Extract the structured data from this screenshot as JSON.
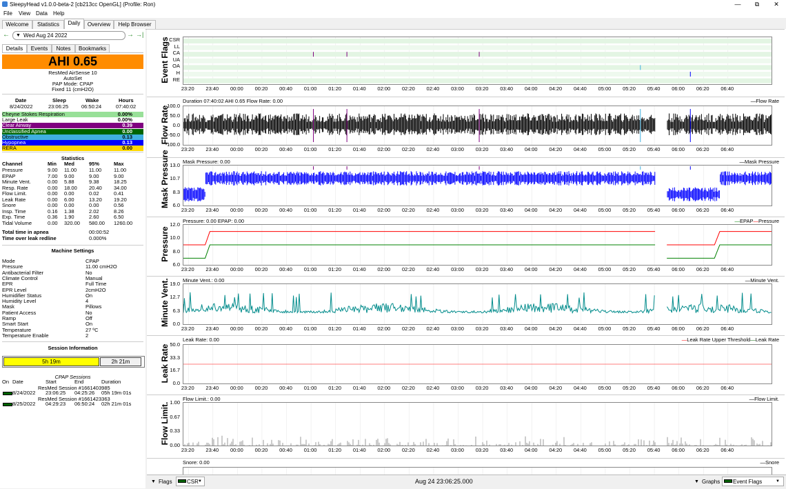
{
  "window": {
    "title": "SleepyHead v1.0.0-beta-2 [cb213cc OpenGL] (Profile: Ron)"
  },
  "menu": [
    "File",
    "View",
    "Data",
    "Help"
  ],
  "tabs": [
    "Welcome",
    "Statistics",
    "Daily",
    "Overview",
    "Help Browser"
  ],
  "active_tab": "Daily",
  "date_nav": {
    "date": "Wed Aug 24 2022",
    "back": "←",
    "forward": "→",
    "jump": "→|"
  },
  "subtabs": [
    "Details",
    "Events",
    "Notes",
    "Bookmarks"
  ],
  "ahi": {
    "label": "AHI 0.65",
    "color": "#ff8c00"
  },
  "machine": {
    "model": "ResMed AirSense 10",
    "series": "AutoSet",
    "mode_line": "PAP Mode: CPAP",
    "fixed": "Fixed 11 (cmH2O)"
  },
  "sleep_summary": {
    "headers": [
      "Date",
      "Sleep",
      "Wake",
      "Hours"
    ],
    "values": [
      "8/24/2022",
      "23:06:25",
      "06:50:24",
      "07:40:02"
    ]
  },
  "events": [
    {
      "name": "Cheyne Stokes Respiration",
      "value": "0.00%",
      "color": "#98e098"
    },
    {
      "name": "Large Leak",
      "value": "0.00%",
      "color": "#ffffff"
    },
    {
      "name": "Clear Airway",
      "value": "0.39",
      "color": "#800080"
    },
    {
      "name": "Unclassified Apnea",
      "value": "0.00",
      "color": "#006400"
    },
    {
      "name": "Obstructive",
      "value": "0.13",
      "color": "#40b0e0"
    },
    {
      "name": "Hypopnea",
      "value": "0.13",
      "color": "#0000ff"
    },
    {
      "name": "RERA",
      "value": "0.00",
      "color": "#ffd700"
    }
  ],
  "statistics": {
    "title": "Statistics",
    "headers": [
      "Channel",
      "Min",
      "Med",
      "95%",
      "Max"
    ],
    "rows": [
      [
        "Pressure",
        "9.00",
        "11.00",
        "11.00",
        "11.00"
      ],
      [
        "EPAP",
        "7.00",
        "9.00",
        "9.00",
        "9.00"
      ],
      [
        "Minute Vent.",
        "0.00",
        "5.88",
        "9.38",
        "18.25"
      ],
      [
        "Resp. Rate",
        "0.00",
        "18.00",
        "20.40",
        "34.00"
      ],
      [
        "Flow Limit.",
        "0.00",
        "0.00",
        "0.02",
        "0.41"
      ],
      [
        "Leak Rate",
        "0.00",
        "6.00",
        "13.20",
        "19.20"
      ],
      [
        "Snore",
        "0.00",
        "0.00",
        "0.00",
        "0.56"
      ],
      [
        "Insp. Time",
        "0.16",
        "1.38",
        "2.02",
        "8.26"
      ],
      [
        "Exp. Time",
        "0.36",
        "1.90",
        "2.60",
        "6.50"
      ],
      [
        "Tidal Volume",
        "0.00",
        "320.00",
        "580.00",
        "1260.00"
      ]
    ]
  },
  "apnea_time": [
    {
      "label": "Total time in apnea",
      "value": "00:00:52"
    },
    {
      "label": "Time over leak redline",
      "value": "0.000%"
    }
  ],
  "machine_settings": {
    "title": "Machine Settings",
    "rows": [
      [
        "Mode",
        "CPAP"
      ],
      [
        "Pressure",
        "11.00 cmH2O"
      ],
      [
        "Antibacterial Filter",
        "No"
      ],
      [
        "Climate Control",
        "Manual"
      ],
      [
        "EPR",
        "Full Time"
      ],
      [
        "EPR Level",
        "2cmH2O"
      ],
      [
        "Humidifier Status",
        "On"
      ],
      [
        "Humidity Level",
        "4"
      ],
      [
        "Mask",
        "Pillows"
      ],
      [
        "Patient Access",
        "No"
      ],
      [
        "Ramp",
        "Off"
      ],
      [
        "Smart Start",
        "On"
      ],
      [
        "Temperature",
        "27 ºC"
      ],
      [
        "Temperature Enable",
        "2"
      ]
    ]
  },
  "session_info": {
    "title": "Session Information",
    "bar1": "5h 19m",
    "bar2": "2h 21m",
    "bar1_fraction": 0.69,
    "cpap_title": "CPAP Sessions",
    "headers": [
      "On",
      "Date",
      "Start",
      "End",
      "Duration"
    ],
    "sessions": [
      {
        "label": "ResMed Session #1661403985",
        "date": "8/24/2022",
        "start": "23:06:25",
        "end": "04:25:26",
        "duration": "05h 19m 01s"
      },
      {
        "label": "ResMed Session #1661423363",
        "date": "8/25/2022",
        "start": "04:29:23",
        "end": "06:50:24",
        "duration": "02h 21m 01s"
      }
    ]
  },
  "xticks": [
    "23:20",
    "23:40",
    "00:00",
    "00:20",
    "00:40",
    "01:00",
    "01:20",
    "01:40",
    "02:00",
    "02:20",
    "02:40",
    "03:00",
    "03:20",
    "03:40",
    "04:00",
    "04:20",
    "04:40",
    "05:00",
    "05:20",
    "05:40",
    "06:00",
    "06:20",
    "06:40"
  ],
  "graphs": {
    "event_flags": {
      "title": "Event Flags",
      "flags": [
        "CSR",
        "LL",
        "CA",
        "UA",
        "OA",
        "H",
        "RE"
      ]
    },
    "flow_rate": {
      "title": "Flow Rate",
      "header": "Duration 07:40:02 AHI 0.65 Flow Rate: 0.00",
      "legend": "Flow Rate",
      "yticks": [
        "100.0",
        "50.0",
        "0.0",
        "-50.0",
        "-100.0"
      ]
    },
    "mask_pressure": {
      "title": "Mask Pressure",
      "header": "Mask Pressure: 0.00",
      "legend": "Mask Pressure",
      "yticks": [
        "13.0",
        "10.7",
        "8.3",
        "6.0"
      ]
    },
    "pressure": {
      "title": "Pressure",
      "header": "Pressure: 0.00 EPAP: 0.00",
      "legend_epap": "EPAP",
      "legend_pressure": "Pressure",
      "yticks": [
        "12.0",
        "10.0",
        "8.0",
        "6.0"
      ]
    },
    "minute_vent": {
      "title": "Minute Vent.",
      "header": "Minute Vent.: 0.00",
      "legend": "Minute Vent.",
      "yticks": [
        "19.0",
        "12.7",
        "6.3",
        "0.0"
      ]
    },
    "leak_rate": {
      "title": "Leak Rate",
      "header": "Leak Rate: 0.00",
      "legend_threshold": "Leak Rate Upper Threshold",
      "legend": "Leak Rate",
      "yticks": [
        "50.0",
        "33.3",
        "16.7",
        "0.0"
      ]
    },
    "flow_limit": {
      "title": "Flow Limit.",
      "header": "Flow Limit.: 0.00",
      "legend": "Flow Limit.",
      "yticks": [
        "1.00",
        "0.67",
        "0.33",
        "0.00"
      ]
    },
    "snore": {
      "header": "Snore: 0.00",
      "legend": "Snore"
    }
  },
  "bottom": {
    "flags": "Flags",
    "csr": "CSR",
    "timestamp": "Aug 24 23:06:25.000",
    "graphs": "Graphs",
    "event_flags": "Event Flags"
  },
  "colors": {
    "ahi": "#ff8c00",
    "flow": "#000000",
    "mask": "#0000ff",
    "pressure": "#ff0000",
    "epap": "#008000",
    "minute": "#008b8b",
    "leak": "#006400",
    "flowlimit": "#999999",
    "session_bar": "#ffff00"
  }
}
